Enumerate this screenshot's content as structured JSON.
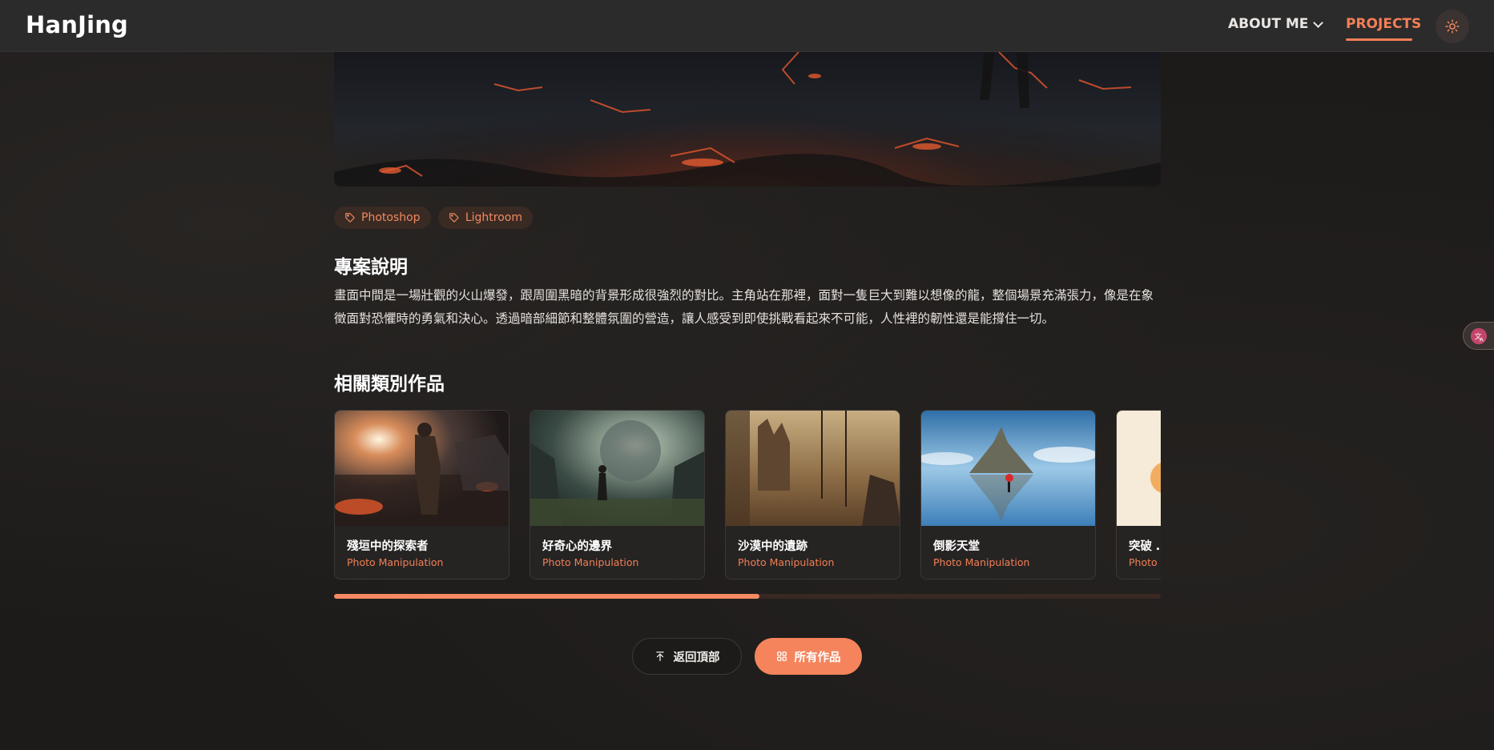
{
  "nav": {
    "logo": "HanJing",
    "about_label": "ABOUT ME",
    "projects_label": "PROJECTS",
    "theme_icon": "sun-icon"
  },
  "tags": [
    {
      "label": "Photoshop",
      "icon": "tag-icon"
    },
    {
      "label": "Lightroom",
      "icon": "tag-icon"
    }
  ],
  "description": {
    "heading": "專案說明",
    "text": "畫面中間是一場壯觀的火山爆發，跟周圍黑暗的背景形成很強烈的對比。主角站在那裡，面對一隻巨大到難以想像的龍，整個場景充滿張力，像是在象徵面對恐懼時的勇氣和決心。透過暗部細節和整體氛圍的營造，讓人感受到即使挑戰看起來不可能，人性裡的韌性還是能撐住一切。"
  },
  "related": {
    "heading": "相關類別作品",
    "cards": [
      {
        "title": "殘垣中的探索者",
        "category": "Photo Manipulation"
      },
      {
        "title": "好奇心的邊界",
        "category": "Photo Manipulation"
      },
      {
        "title": "沙漠中的遺跡",
        "category": "Photo Manipulation"
      },
      {
        "title": "倒影天堂",
        "category": "Photo Manipulation"
      },
      {
        "title": "突破 …",
        "category": "Photo Manipulation"
      }
    ],
    "scroll_progress": 0.515
  },
  "actions": {
    "back_to_top": "返回頂部",
    "all_works": "所有作品"
  },
  "colors": {
    "accent": "#f5845c",
    "background": "#1e1c1b",
    "nav_bg": "#2c2b2b"
  }
}
